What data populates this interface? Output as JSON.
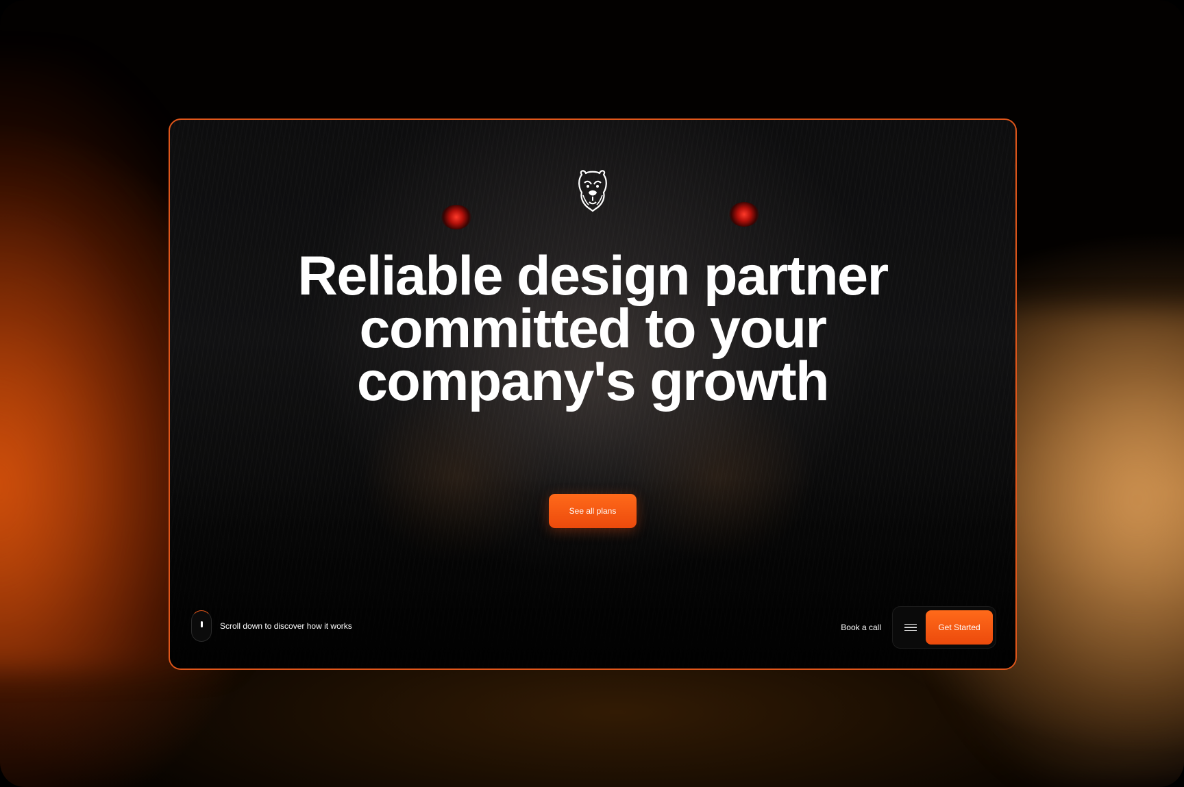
{
  "hero": {
    "logo_icon": "bear-head-icon",
    "headline": "Reliable design partner committed to your company's growth",
    "cta_label": "See all plans"
  },
  "footer_bar": {
    "scroll_icon": "mouse-scroll-icon",
    "scroll_text": "Scroll down to discover how it works",
    "book_call_label": "Book a call",
    "menu_icon": "hamburger-menu-icon",
    "get_started_label": "Get Started"
  },
  "colors": {
    "accent": "#ec4a0c",
    "accent_light": "#ff6a1a",
    "card_border": "#e0561a",
    "text": "#ffffff",
    "background": "#030100"
  }
}
